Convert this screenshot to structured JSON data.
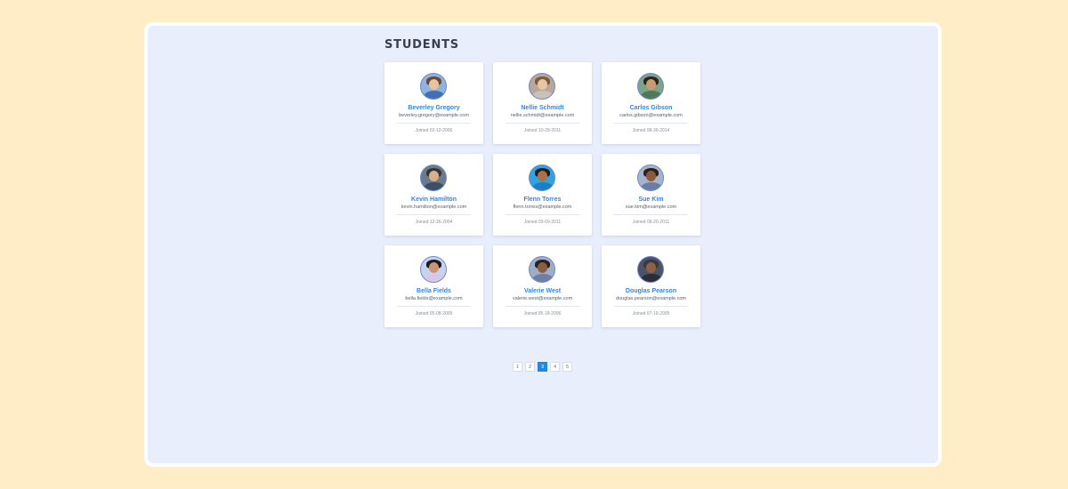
{
  "page": {
    "title": "STUDENTS"
  },
  "colors": {
    "outer_background": "#FFEDC8",
    "panel_background": "#E8EEFC",
    "name_accent": "#2F86E8",
    "active_page": "#1E88E5"
  },
  "students": [
    {
      "name": "Beverley Gregory",
      "email": "beverley.gregory@example.com",
      "joined": "Joined 02-12-2006",
      "avatar_icon": "person-photo-icon",
      "skin": "#E9C2A0",
      "hair": "#6B4A2B",
      "shirt": "#3F6FB5",
      "bg": "#8FB3E0"
    },
    {
      "name": "Nellie Schmidt",
      "email": "nellie.schmidt@example.com",
      "joined": "Joined 10-28-2011",
      "avatar_icon": "person-photo-icon",
      "skin": "#E8C4A8",
      "hair": "#7A5A3C",
      "shirt": "#C9C2BA",
      "bg": "#B9A79A"
    },
    {
      "name": "Carlos Gibson",
      "email": "carlos.gibson@example.com",
      "joined": "Joined 08-30-2014",
      "avatar_icon": "person-photo-icon",
      "skin": "#C99A74",
      "hair": "#2A2420",
      "shirt": "#4F7A5A",
      "bg": "#7FA386"
    },
    {
      "name": "Kevin Hamilton",
      "email": "kevin.hamilton@example.com",
      "joined": "Joined 12-26-2004",
      "avatar_icon": "person-photo-icon",
      "skin": "#D9B08C",
      "hair": "#3B3431",
      "shirt": "#3D4F66",
      "bg": "#6C7B8C"
    },
    {
      "name": "Flenn Torres",
      "email": "flenn.torres@example.com",
      "joined": "Joined 03-09-2011",
      "avatar_icon": "person-photo-icon",
      "skin": "#A9714A",
      "hair": "#1E1A18",
      "shirt": "#1B7FC2",
      "bg": "#2FA4E0"
    },
    {
      "name": "Sue Kim",
      "email": "sue.kim@example.com",
      "joined": "Joined 06-20-2011",
      "avatar_icon": "person-photo-icon",
      "skin": "#8A5A3C",
      "hair": "#2B211C",
      "shirt": "#6B7DA0",
      "bg": "#A5B3CC"
    },
    {
      "name": "Bella Fields",
      "email": "bella.fields@example.com",
      "joined": "Joined 05-08-2009",
      "avatar_icon": "person-photo-icon",
      "skin": "#C99574",
      "hair": "#1F1A19",
      "shirt": "#D8C8E8",
      "bg": "#C7D2EE"
    },
    {
      "name": "Valerie West",
      "email": "valerie.west@example.com",
      "joined": "Joined 05-18-2006",
      "avatar_icon": "person-photo-icon",
      "skin": "#8B5E42",
      "hair": "#2A211D",
      "shirt": "#6E7FA3",
      "bg": "#9FAEC6"
    },
    {
      "name": "Douglas Pearson",
      "email": "douglas.pearson@example.com",
      "joined": "Joined 07-19-2005",
      "avatar_icon": "person-photo-icon",
      "skin": "#8F6248",
      "hair": "#3A3A3A",
      "shirt": "#2A2E38",
      "bg": "#4A5368"
    }
  ],
  "pagination": {
    "pages": [
      "1",
      "2",
      "3",
      "4",
      "5"
    ],
    "current": "3"
  }
}
